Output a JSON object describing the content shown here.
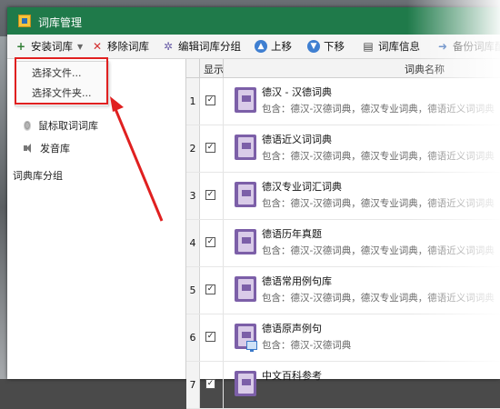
{
  "window": {
    "title": "词库管理"
  },
  "toolbar": [
    {
      "label": "安装词库",
      "icon": "plus-icon",
      "dropdown": true
    },
    {
      "label": "移除词库",
      "icon": "remove-icon"
    },
    {
      "label": "编辑词库分组",
      "icon": "gear-icon"
    },
    {
      "label": "上移",
      "icon": "arrow-up-icon"
    },
    {
      "label": "下移",
      "icon": "arrow-down-icon"
    },
    {
      "label": "词库信息",
      "icon": "info-icon"
    },
    {
      "label": "备份词库配",
      "icon": "backup-icon"
    }
  ],
  "install_menu": {
    "items": [
      "选择文件...",
      "选择文件夹..."
    ]
  },
  "tree": {
    "items": [
      {
        "label": "鼠标取词词库",
        "icon": "mouse-icon"
      },
      {
        "label": "发音库",
        "icon": "speaker-icon"
      }
    ],
    "group_label": "词典库分组"
  },
  "table": {
    "columns": [
      "显示",
      "词典名称"
    ],
    "rows": [
      {
        "num": "1",
        "checked": true,
        "name": "德汉 - 汉德词典",
        "desc": "包含：德汉-汉德词典，德汉专业词典，德语近义词词典"
      },
      {
        "num": "2",
        "checked": true,
        "name": "德语近义词词典",
        "desc": "包含：德汉-汉德词典，德汉专业词典，德语近义词词典"
      },
      {
        "num": "3",
        "checked": true,
        "name": "德汉专业词汇词典",
        "desc": "包含：德汉-汉德词典，德汉专业词典，德语近义词词典"
      },
      {
        "num": "4",
        "checked": true,
        "name": "德语历年真题",
        "desc": "包含：德汉-汉德词典，德汉专业词典，德语近义词词典"
      },
      {
        "num": "5",
        "checked": true,
        "name": "德语常用例句库",
        "desc": "包含：德汉-汉德词典，德汉专业词典，德语近义词词典"
      },
      {
        "num": "6",
        "checked": true,
        "name": "德语原声例句",
        "desc": "包含：德汉-汉德词典"
      },
      {
        "num": "7",
        "checked": true,
        "name": "中文百科参考",
        "desc": ""
      }
    ]
  },
  "colors": {
    "titlebar": "#1f7a4a",
    "highlight": "#e02020",
    "book": "#7c5fa8"
  }
}
